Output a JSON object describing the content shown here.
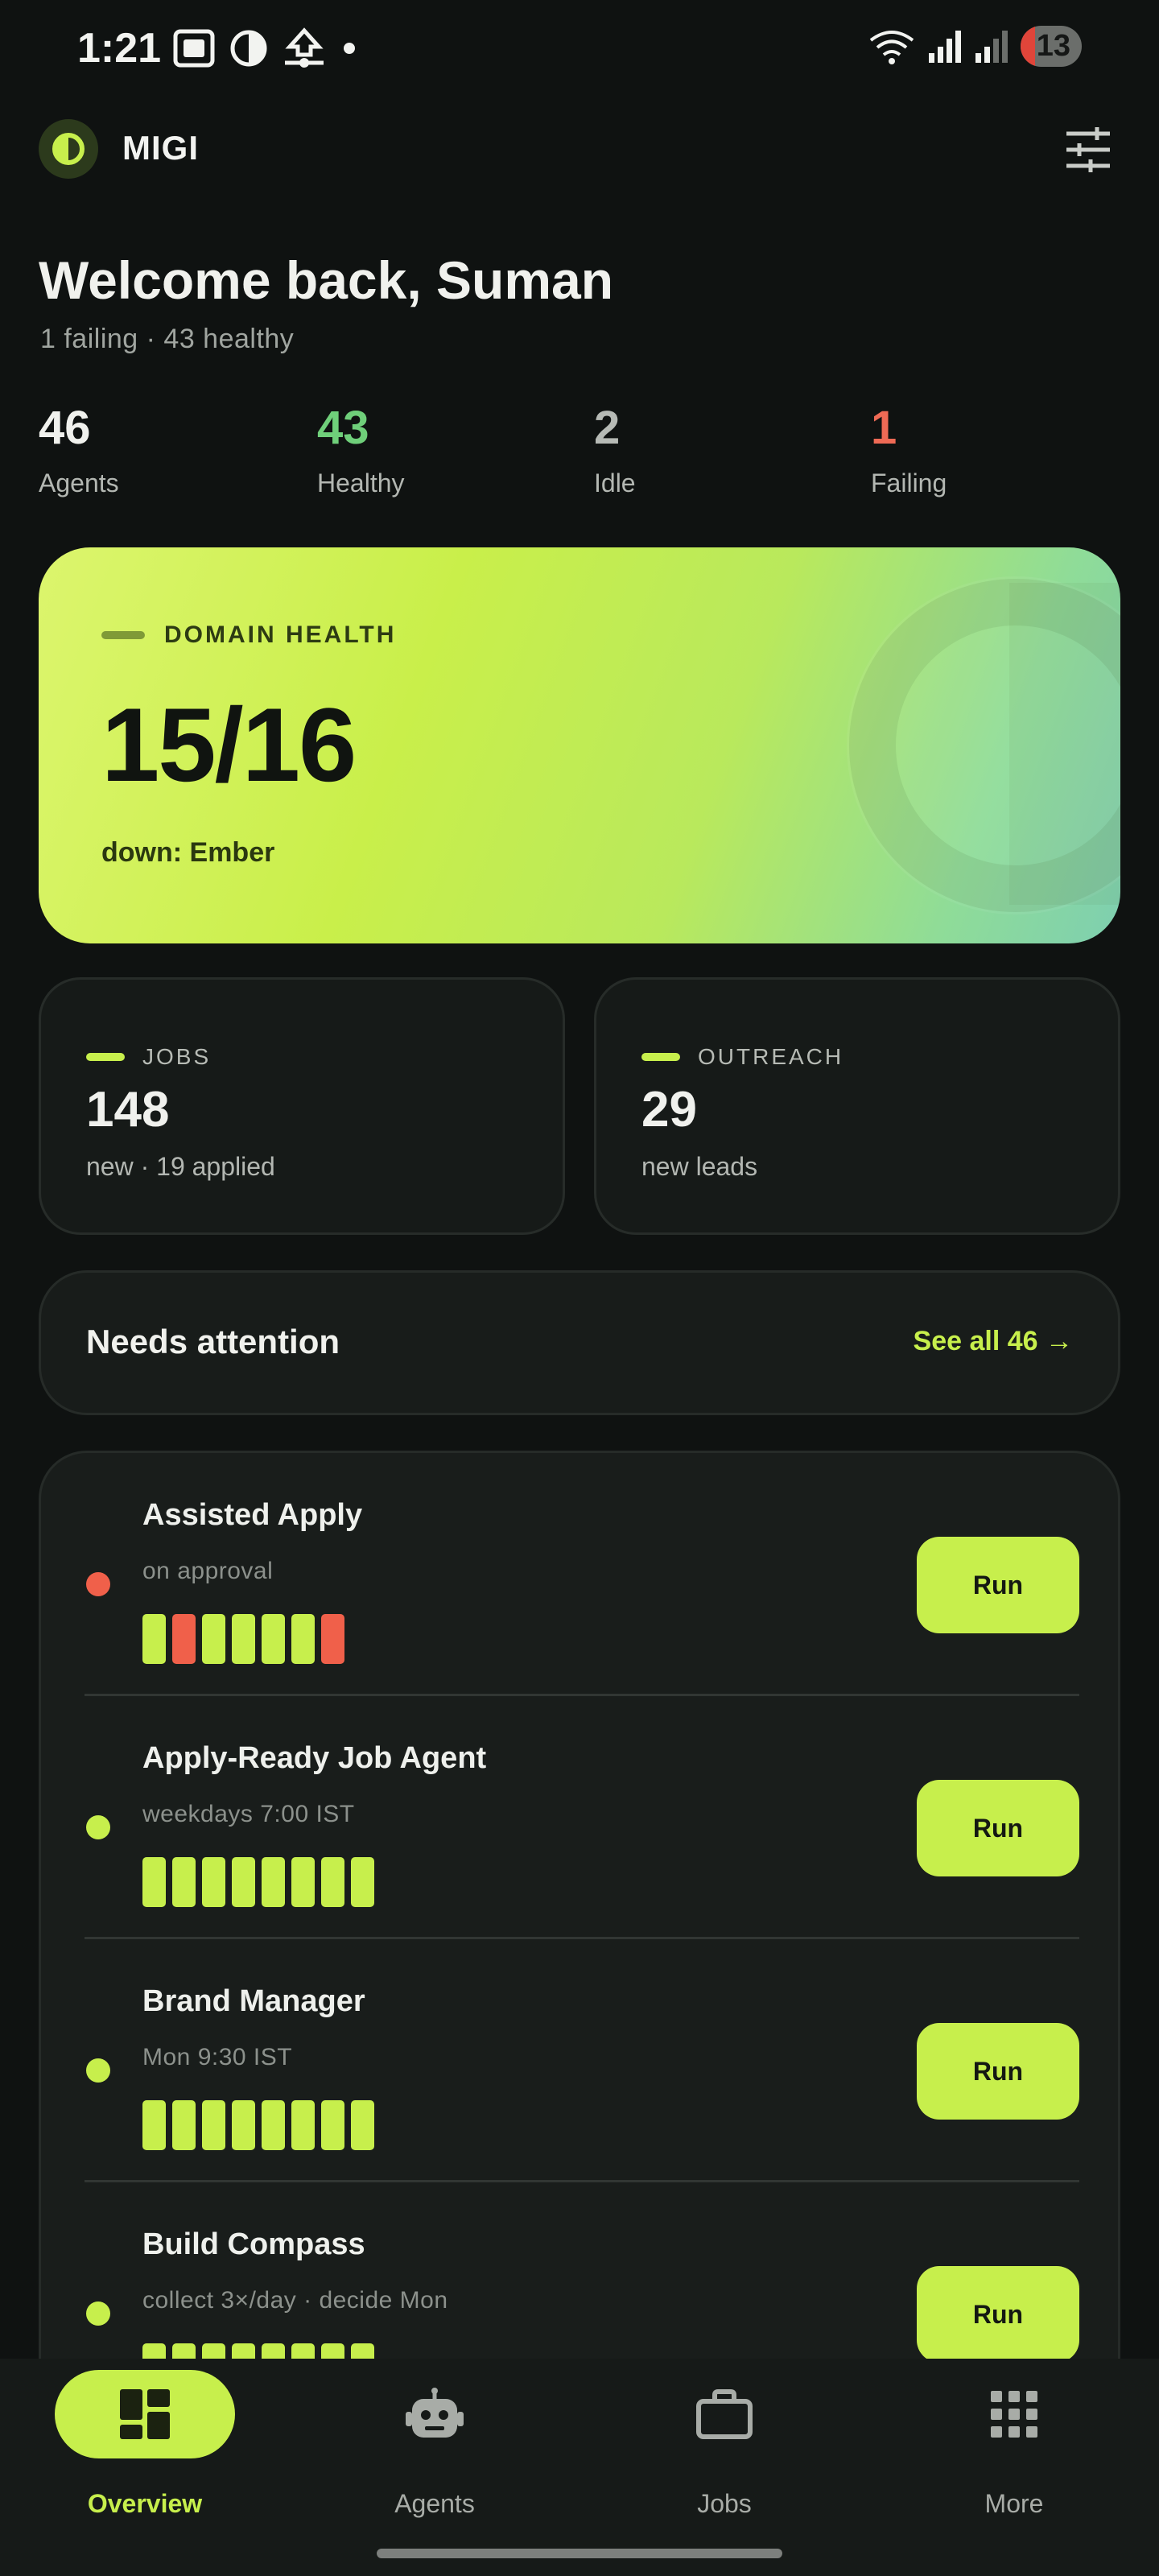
{
  "status_bar": {
    "time": "1:21",
    "left_icons": [
      "screenshot-icon",
      "contrast-icon",
      "sync-icon",
      "dot-icon"
    ],
    "right_icons": [
      "wifi-icon",
      "signal-icon",
      "roaming-signal-icon"
    ],
    "battery_level": "13"
  },
  "header": {
    "app_name": "MIGI",
    "settings_icon": "sliders-icon"
  },
  "welcome": {
    "title": "Welcome back, Suman",
    "subtitle": "1 failing · 43 healthy"
  },
  "stats": [
    {
      "value": "46",
      "label": "Agents",
      "color": "#f0f1ed"
    },
    {
      "value": "43",
      "label": "Healthy",
      "color": "#6fcf7a"
    },
    {
      "value": "2",
      "label": "Idle",
      "color": "#b6bab5"
    },
    {
      "value": "1",
      "label": "Failing",
      "color": "#ee6a55"
    }
  ],
  "domain_health": {
    "label": "DOMAIN HEALTH",
    "value": "15/16",
    "footer": "down: Ember"
  },
  "jobs": {
    "label": "JOBS",
    "value": "148",
    "sub": "new · 19 applied"
  },
  "outreach": {
    "label": "OUTREACH",
    "value": "29",
    "sub": "new leads"
  },
  "attention": {
    "title": "Needs attention",
    "link": "See all 46 →"
  },
  "colors": {
    "accent": "#c7ef4c",
    "fail": "#f0604a",
    "ok": "#c7ef4c"
  },
  "agents": [
    {
      "name": "Assisted Apply",
      "schedule": "on approval",
      "status": "fail",
      "runs": [
        "ok",
        "fail",
        "ok",
        "ok",
        "ok",
        "ok",
        "fail"
      ],
      "action": "Run"
    },
    {
      "name": "Apply-Ready Job Agent",
      "schedule": "weekdays 7:00 IST",
      "status": "ok",
      "runs": [
        "ok",
        "ok",
        "ok",
        "ok",
        "ok",
        "ok",
        "ok",
        "ok"
      ],
      "action": "Run"
    },
    {
      "name": "Brand Manager",
      "schedule": "Mon 9:30 IST",
      "status": "ok",
      "runs": [
        "ok",
        "ok",
        "ok",
        "ok",
        "ok",
        "ok",
        "ok",
        "ok"
      ],
      "action": "Run"
    },
    {
      "name": "Build Compass",
      "schedule": "collect 3×/day · decide Mon",
      "status": "ok",
      "runs": [
        "ok",
        "ok",
        "ok",
        "ok",
        "ok",
        "ok",
        "ok",
        "ok"
      ],
      "action": "Run"
    }
  ],
  "nav": [
    {
      "label": "Overview",
      "icon": "dashboard-icon",
      "active": true
    },
    {
      "label": "Agents",
      "icon": "robot-icon",
      "active": false
    },
    {
      "label": "Jobs",
      "icon": "briefcase-icon",
      "active": false
    },
    {
      "label": "More",
      "icon": "grid-icon",
      "active": false
    }
  ]
}
